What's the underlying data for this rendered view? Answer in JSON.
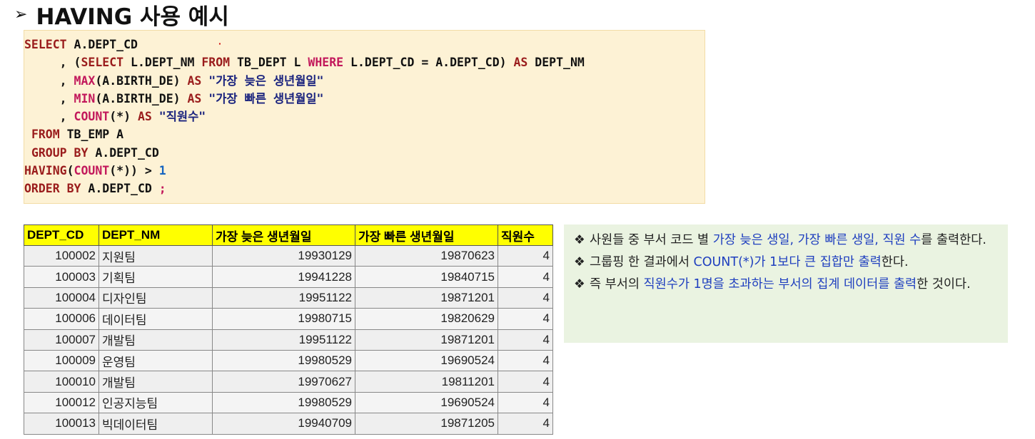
{
  "header": {
    "arrow": "➢",
    "title": "HAVING 사용 예시"
  },
  "code": {
    "l1_select": "SELECT",
    "l1_rest": " A.DEPT_CD",
    "l2_pre": "     , (",
    "l2_select": "SELECT",
    "l2_a": " L.DEPT_NM ",
    "l2_from": "FROM",
    "l2_b": " TB_DEPT L ",
    "l2_where": "WHERE",
    "l2_c": " L.DEPT_CD = A.DEPT_CD) ",
    "l2_as": "AS",
    "l2_d": " DEPT_NM",
    "l3_pre": "     , ",
    "l3_fn": "MAX",
    "l3_a": "(A.BIRTH_DE) ",
    "l3_as": "AS",
    "l3_str": " \"가장 늦은 생년월일\"",
    "l4_pre": "     , ",
    "l4_fn": "MIN",
    "l4_a": "(A.BIRTH_DE) ",
    "l4_as": "AS",
    "l4_str": " \"가장 빠른 생년월일\"",
    "l5_pre": "     , ",
    "l5_fn": "COUNT",
    "l5_a": "(*) ",
    "l5_as": "AS",
    "l5_str": " \"직원수\"",
    "l6_pre": " ",
    "l6_from": "FROM",
    "l6_a": " TB_EMP A",
    "l7_pre": " ",
    "l7_group": "GROUP BY",
    "l7_a": " A.DEPT_CD",
    "l8_having": "HAVING",
    "l8_a": "(",
    "l8_fn": "COUNT",
    "l8_b": "(*)) > ",
    "l8_num": "1",
    "l9_order": "ORDER BY",
    "l9_a": " A.DEPT_CD ",
    "l9_semi": ";"
  },
  "table": {
    "headers": [
      "DEPT_CD",
      "DEPT_NM",
      "가장 늦은 생년월일",
      "가장 빠른 생년월일",
      "직원수"
    ],
    "rows": [
      [
        "100002",
        "지원팀",
        "19930129",
        "19870623",
        "4"
      ],
      [
        "100003",
        "기획팀",
        "19941228",
        "19840715",
        "4"
      ],
      [
        "100004",
        "디자인팀",
        "19951122",
        "19871201",
        "4"
      ],
      [
        "100006",
        "데이터팀",
        "19980715",
        "19820629",
        "4"
      ],
      [
        "100007",
        "개발팀",
        "19951122",
        "19871201",
        "4"
      ],
      [
        "100009",
        "운영팀",
        "19980529",
        "19690524",
        "4"
      ],
      [
        "100010",
        "개발팀",
        "19970627",
        "19811201",
        "4"
      ],
      [
        "100012",
        "인공지능팀",
        "19980529",
        "19690524",
        "4"
      ],
      [
        "100013",
        "빅데이터팀",
        "19940709",
        "19871205",
        "4"
      ]
    ]
  },
  "notes": {
    "bullet": "❖",
    "n1_a": "사원들 중 부서 코드 별 ",
    "n1_b": "가장 늦은 생일, 가장 빠른 생일, 직원 수",
    "n1_c": "를 출력한다.",
    "n2_a": "그룹핑 한 결과에서 ",
    "n2_b": "COUNT(*)가 1보다 큰 집합만 출력",
    "n2_c": "한다.",
    "n3_a": "즉 부서의 ",
    "n3_b": "직원수가 1명을 초과하는 부서의 집계 데이터를 출력",
    "n3_c": "한 것이다."
  },
  "colors": {
    "code_bg": "#fdf2d5",
    "keyword": "#9a1c1c",
    "function": "#c2185b",
    "string": "#1a237e",
    "table_header": "#ffff00",
    "note_bg": "#eaf3e1",
    "highlight": "#1f3fbf"
  }
}
